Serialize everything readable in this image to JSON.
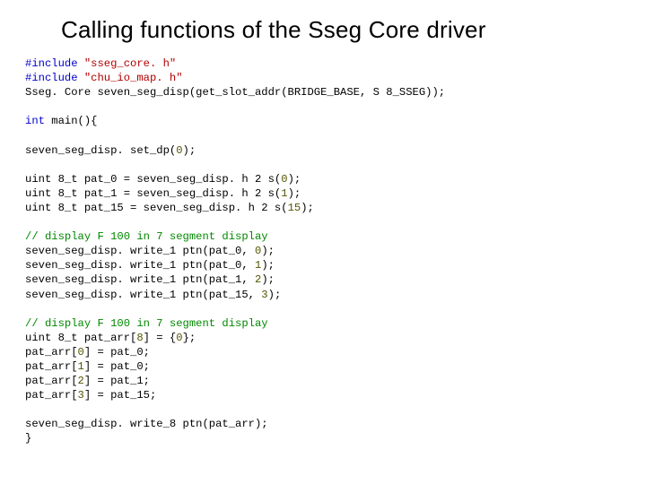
{
  "title": "Calling functions of the Sseg Core driver",
  "code": {
    "inc1_kw": "#include",
    "inc1_str": "\"sseg_core. h\"",
    "inc2_kw": "#include",
    "inc2_str": "\"chu_io_map. h\"",
    "decl_line": "Sseg. Core seven_seg_disp(get_slot_addr(BRIDGE_BASE, S 8_SSEG));",
    "main_kw": "int",
    "main_rest": " main(){",
    "setdp_pre": "seven_seg_disp. set_dp(",
    "setdp_num": "0",
    "setdp_post": ");",
    "p0_pre": "uint 8_t pat_0 = seven_seg_disp. h 2 s(",
    "p0_num": "0",
    "p0_post": ");",
    "p1_pre": "uint 8_t pat_1 = seven_seg_disp. h 2 s(",
    "p1_num": "1",
    "p1_post": ");",
    "p15_pre": "uint 8_t pat_15 = seven_seg_disp. h 2 s(",
    "p15_num": "15",
    "p15_post": ");",
    "cm1": "// display F 100 in 7 segment display",
    "w1_pre": "seven_seg_disp. write_1 ptn(pat_0, ",
    "w1_num": "0",
    "w1_post": ");",
    "w2_pre": "seven_seg_disp. write_1 ptn(pat_0, ",
    "w2_num": "1",
    "w2_post": ");",
    "w3_pre": "seven_seg_disp. write_1 ptn(pat_1, ",
    "w3_num": "2",
    "w3_post": ");",
    "w4_pre": "seven_seg_disp. write_1 ptn(pat_15, ",
    "w4_num": "3",
    "w4_post": ");",
    "cm2": "// display F 100 in 7 segment display",
    "arr_pre": "uint 8_t pat_arr[",
    "arr_sz": "8",
    "arr_mid": "] = {",
    "arr_init": "0",
    "arr_post": "};",
    "a0_pre": "pat_arr[",
    "a0_idx": "0",
    "a0_post": "] = pat_0;",
    "a1_pre": "pat_arr[",
    "a1_idx": "1",
    "a1_post": "] = pat_0;",
    "a2_pre": "pat_arr[",
    "a2_idx": "2",
    "a2_post": "] = pat_1;",
    "a3_pre": "pat_arr[",
    "a3_idx": "3",
    "a3_post": "] = pat_15;",
    "w8": "seven_seg_disp. write_8 ptn(pat_arr);",
    "close": "}"
  }
}
